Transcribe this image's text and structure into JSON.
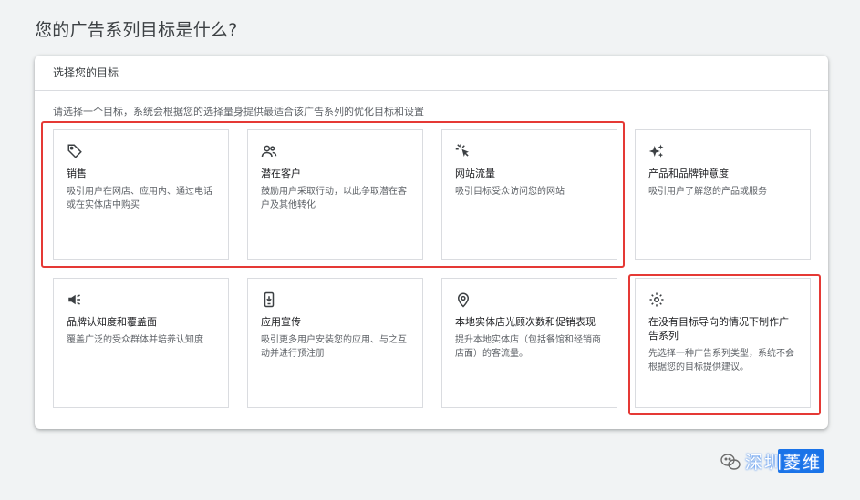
{
  "page": {
    "title": "您的广告系列目标是什么?"
  },
  "panel": {
    "header": "选择您的目标",
    "instructions": "请选择一个目标，系统会根据您的选择量身提供最适合该广告系列的优化目标和设置"
  },
  "goals": [
    {
      "title": "销售",
      "desc": "吸引用户在网店、应用内、通过电话或在实体店中购买",
      "icon": "tag-icon"
    },
    {
      "title": "潜在客户",
      "desc": "鼓励用户采取行动，以此争取潜在客户及其他转化",
      "icon": "people-icon"
    },
    {
      "title": "网站流量",
      "desc": "吸引目标受众访问您的网站",
      "icon": "click-sparkle-icon"
    },
    {
      "title": "产品和品牌钟意度",
      "desc": "吸引用户了解您的产品或服务",
      "icon": "sparkles-icon"
    },
    {
      "title": "品牌认知度和覆盖面",
      "desc": "覆盖广泛的受众群体并培养认知度",
      "icon": "megaphone-icon"
    },
    {
      "title": "应用宣传",
      "desc": "吸引更多用户安装您的应用、与之互动并进行预注册",
      "icon": "phone-download-icon"
    },
    {
      "title": "本地实体店光顾次数和促销表现",
      "desc": "提升本地实体店（包括餐馆和经销商店面）的客流量。",
      "icon": "location-pin-icon"
    },
    {
      "title": "在没有目标导向的情况下制作广告系列",
      "desc": "先选择一种广告系列类型，系统不会根据您的目标提供建议。",
      "icon": "gear-icon"
    }
  ],
  "watermark": {
    "text": "深圳菱维",
    "icon": "wechat-logo-icon"
  },
  "colors": {
    "highlight": "#e53935",
    "background": "#f1f3f4",
    "accent": "#1a73e8"
  }
}
